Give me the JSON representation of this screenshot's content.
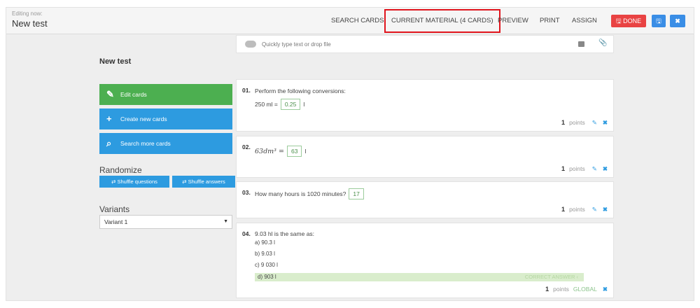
{
  "header": {
    "editing_label": "Editing now:",
    "title": "New test",
    "nav": [
      "SEARCH CARDS",
      "CURRENT MATERIAL (4 CARDS)",
      "PREVIEW",
      "PRINT",
      "ASSIGN"
    ],
    "done_label": "DONE",
    "close_label": "✖"
  },
  "left": {
    "title": "New test",
    "edit_cards": "Edit cards",
    "create_cards": "Create new cards",
    "search_cards": "Search more cards",
    "randomize_heading": "Randomize",
    "shuffle_questions": "Shuffle questions",
    "shuffle_answers": "Shuffle answers",
    "variants_heading": "Variants",
    "variant_selected": "Variant 1"
  },
  "dropbox": {
    "placeholder": "Quickly type text or drop file"
  },
  "cards": [
    {
      "num": "01.",
      "text": "Perform the following conversions:",
      "prefix": "250 ml =",
      "answer": "0.25",
      "unit": "l",
      "points": "1",
      "points_label": "points"
    },
    {
      "num": "02.",
      "prefix": "63dm³ =",
      "answer": "63",
      "unit": "l",
      "points": "1",
      "points_label": "points"
    },
    {
      "num": "03.",
      "text": "How many hours is 1020 minutes?",
      "answer": "17",
      "points": "1",
      "points_label": "points"
    },
    {
      "num": "04.",
      "text": "9.03 hl is the same as:",
      "options": [
        {
          "letter": "a)",
          "text": "90.3 l"
        },
        {
          "letter": "b)",
          "text": "9.03 l"
        },
        {
          "letter": "c)",
          "text": "9 030 l"
        },
        {
          "letter": "d)",
          "text": "903 l"
        }
      ],
      "correct_label": "CORRECT ANSWER",
      "points": "1",
      "points_label": "points",
      "global_label": "GLOBAL"
    }
  ],
  "colors": {
    "accent": "#2d9be0",
    "green": "#4caf50",
    "done": "#e94343",
    "highlight": "#e0141c"
  }
}
